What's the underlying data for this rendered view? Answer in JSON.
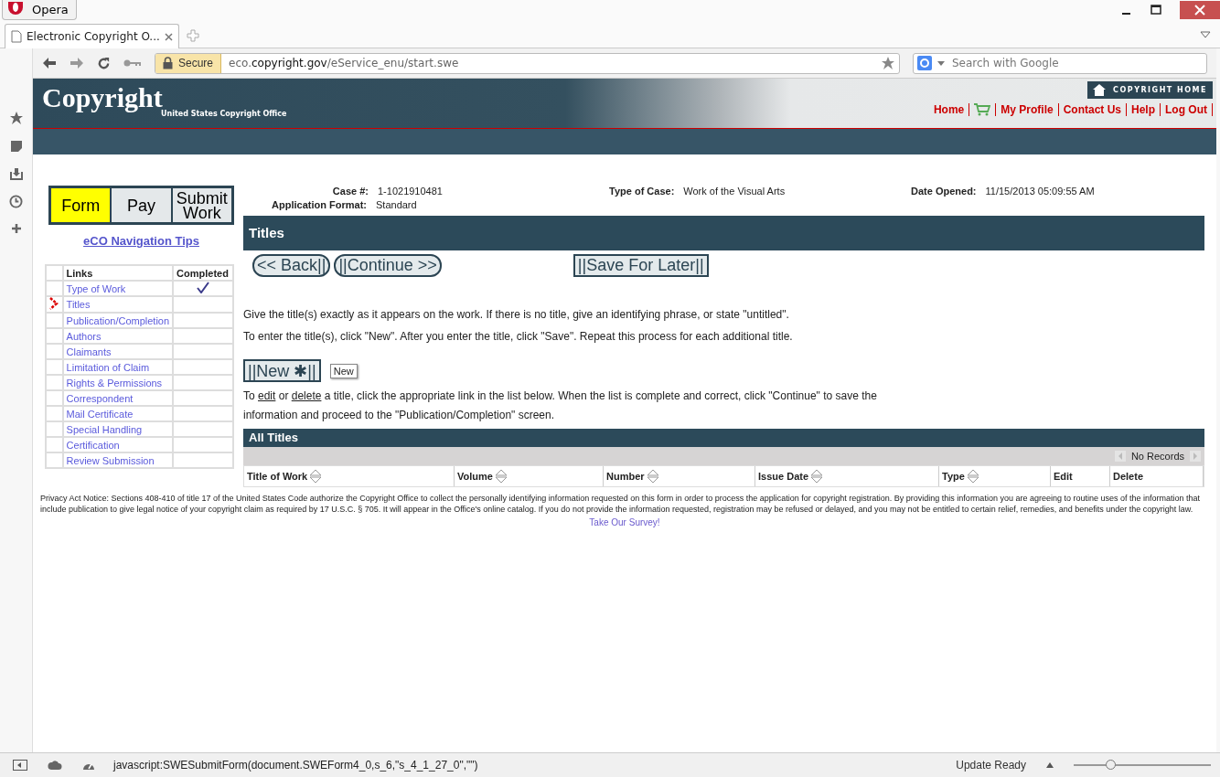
{
  "browser": {
    "app_button": "Opera",
    "tab": {
      "title": "Electronic Copyright O..."
    },
    "address": {
      "secure_label": "Secure",
      "host_prefix": "eco.",
      "domain": "copyright.gov",
      "path": "/eService_enu/start.swe"
    },
    "search": {
      "placeholder": "Search with Google"
    }
  },
  "header": {
    "logo": "Copyright",
    "subtitle": "United States Copyright Office",
    "home_button": "COPYRIGHT HOME",
    "nav": [
      {
        "kind": "link",
        "label": "Home"
      },
      {
        "kind": "cart"
      },
      {
        "kind": "link",
        "label": "My Profile"
      },
      {
        "kind": "link",
        "label": "Contact Us"
      },
      {
        "kind": "link",
        "label": "Help"
      },
      {
        "kind": "link",
        "label": "Log Out"
      }
    ]
  },
  "steps": [
    {
      "label": "Form",
      "selected": true
    },
    {
      "label": "Pay",
      "selected": false
    },
    {
      "label": "Submit Work",
      "selected": false
    }
  ],
  "nav_tips": "eCO Navigation Tips",
  "links_table": {
    "columns": [
      "Links",
      "Completed"
    ],
    "rows": [
      {
        "label": "Type of Work",
        "current": false,
        "completed": true
      },
      {
        "label": "Titles",
        "current": true,
        "completed": false
      },
      {
        "label": "Publication/Completion",
        "current": false,
        "completed": false
      },
      {
        "label": "Authors",
        "current": false,
        "completed": false
      },
      {
        "label": "Claimants",
        "current": false,
        "completed": false
      },
      {
        "label": "Limitation of Claim",
        "current": false,
        "completed": false
      },
      {
        "label": "Rights & Permissions",
        "current": false,
        "completed": false
      },
      {
        "label": "Correspondent",
        "current": false,
        "completed": false
      },
      {
        "label": "Mail Certificate",
        "current": false,
        "completed": false
      },
      {
        "label": "Special Handling",
        "current": false,
        "completed": false
      },
      {
        "label": "Certification",
        "current": false,
        "completed": false
      },
      {
        "label": "Review Submission",
        "current": false,
        "completed": false
      }
    ]
  },
  "case_info": [
    {
      "label": "Case #:",
      "value": "1-1021910481"
    },
    {
      "label": "Type of Case:",
      "value": "Work of the Visual Arts"
    },
    {
      "label": "Date Opened:",
      "value": "11/15/2013 05:09:55 AM"
    },
    {
      "label": "Application Format:",
      "value": "Standard"
    }
  ],
  "section_title": "Titles",
  "nav_buttons": [
    "<< Back||",
    "||Continue >>",
    "||Save For Later||"
  ],
  "instructions": [
    "Give the title(s) exactly as it appears on the work. If there is no title, give an identifying phrase, or state \"untitled\".",
    "To enter the title(s), click \"New\". After you enter the title, click \"Save\". Repeat this process for each additional title."
  ],
  "new_button": "||New ✱||",
  "tooltip": "New",
  "list_note": [
    {
      "kind": "text",
      "text": "To "
    },
    {
      "kind": "link",
      "text": "edit"
    },
    {
      "kind": "text",
      "text": " or "
    },
    {
      "kind": "link",
      "text": "delete"
    },
    {
      "kind": "text",
      "text": " a title, click the appropriate link in the list below. When the list is complete and correct, click \"Continue\" to save the information and proceed to the \"Publication/Completion\" screen."
    }
  ],
  "all_titles": {
    "title": "All Titles",
    "records": "No Records",
    "columns": [
      {
        "label": "Title of Work",
        "sortable": true
      },
      {
        "label": "Volume",
        "sortable": true
      },
      {
        "label": "Number",
        "sortable": true
      },
      {
        "label": "Issue Date",
        "sortable": true
      },
      {
        "label": "Type",
        "sortable": true
      },
      {
        "label": "Edit",
        "sortable": false
      },
      {
        "label": "Delete",
        "sortable": false
      }
    ]
  },
  "privacy_notice": "Privacy Act Notice: Sections 408-410 of title 17 of the United States Code authorize the Copyright Office to collect the personally identifying information requested on this form in order to process the application for copyright registration. By providing this information you are agreeing to routine uses of the information that include publication to give legal notice of your copyright claim as required by 17 U.S.C. § 705. It will appear in the Office's online catalog. If you do not provide the information requested, registration may be refused or delayed, and you may not be entitled to certain relief, remedies, and benefits under the copyright law.",
  "survey_link": "Take Our Survey!",
  "status_bar": {
    "url": "javascript:SWESubmitForm(document.SWEForm4_0,s_6,\"s_4_1_27_0\",\"\")",
    "update": "Update Ready",
    "zoom": {
      "level": 0.27
    }
  }
}
